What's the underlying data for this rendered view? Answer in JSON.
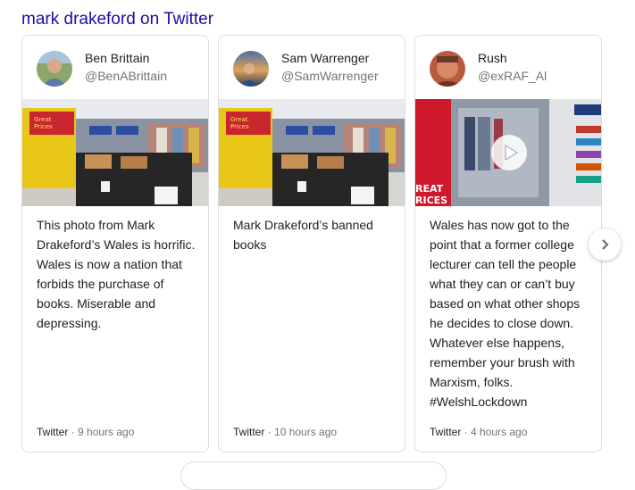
{
  "heading": "mark drakeford on Twitter",
  "cards": [
    {
      "name": "Ben Brittain",
      "handle": "@BenABrittain",
      "text": "This photo from Mark Drakeford’s Wales is horrific. Wales is now a nation that forbids the purchase of books. Miserable and depressing.",
      "source": "Twitter",
      "time": "9 hours ago",
      "media_icon": "store-photo"
    },
    {
      "name": "Sam Warrenger",
      "handle": "@SamWarrenger",
      "text": "Mark Drakeford’s banned books",
      "source": "Twitter",
      "time": "10 hours ago",
      "media_icon": "store-photo"
    },
    {
      "name": "Rush",
      "handle": "@exRAF_Al",
      "text": "Wales has now got to the point that a former college lecturer can tell the people what they can or can’t buy based on what other shops he decides to close down. Whatever else happens, remember your brush with Marxism, folks. #WelshLockdown",
      "source": "Twitter",
      "time": "4 hours ago",
      "media_icon": "video-thumbnail",
      "media_overlay_text": "REAT\nRICES"
    }
  ],
  "separator": " · ",
  "store_sign": {
    "line1": "Great",
    "line2": "Prices"
  },
  "next_icon": "chevron-right-icon",
  "colors": {
    "link": "#1a0dab",
    "text": "#202124",
    "muted": "#70757a",
    "border": "#dadce0"
  }
}
